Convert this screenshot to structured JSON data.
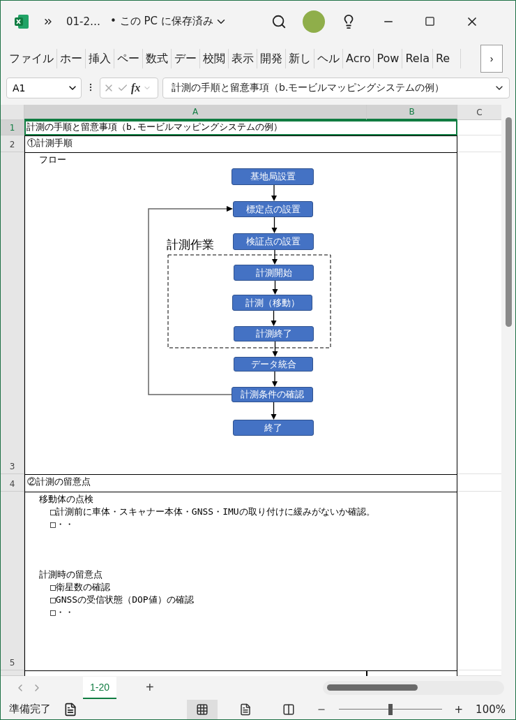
{
  "window": {
    "file_name": "01-2…",
    "save_status": "• この PC に保存済み"
  },
  "ribbon_tabs": [
    "ファイル",
    "ホー",
    "挿入",
    "ペー",
    "数式",
    "デー",
    "校閲",
    "表示",
    "開発",
    "新し",
    "ヘル",
    "Acro",
    "Pow",
    "Rela",
    "Re"
  ],
  "ribbon_more": "›",
  "formula_bar": {
    "name_box": "A1",
    "fx_label": "fx",
    "formula": "計測の手順と留意事項（b.モービルマッピングシステムの例）"
  },
  "columns": [
    {
      "label": "A",
      "selected": true
    },
    {
      "label": "B",
      "selected": true
    },
    {
      "label": "C",
      "selected": false
    }
  ],
  "rows": [
    {
      "number": "1",
      "kind": "title",
      "text": "計測の手順と留意事項（b.モービルマッピングシステムの例）",
      "selected": true
    },
    {
      "number": "2",
      "kind": "heading",
      "text": "①計測手順",
      "selected": false
    },
    {
      "number": "3",
      "kind": "flow",
      "label": "フロー",
      "group_label": "計測作業",
      "selected": false,
      "nodes": [
        "基地局設置",
        "標定点の設置",
        "検証点の設置",
        "計測開始",
        "計測（移動）",
        "計測終了",
        "データ統合",
        "計測条件の確認",
        "終了"
      ]
    },
    {
      "number": "4",
      "kind": "heading",
      "text": "②計測の留意点",
      "selected": false
    },
    {
      "number": "5",
      "kind": "notes",
      "selected": false,
      "sections": [
        {
          "heading": "移動体の点検",
          "items": [
            "□計測前に車体・スキャナー本体・GNSS・IMUの取り付けに緩みがないか確認。",
            "□・・"
          ]
        },
        {
          "heading": "計測時の留意点",
          "items": [
            "□衛星数の確認",
            "□GNSSの受信状態（DOP値）の確認",
            "□・・"
          ]
        }
      ]
    }
  ],
  "sheet_tabs": [
    {
      "label": "1-20",
      "selected": true
    }
  ],
  "add_sheet": "+",
  "status_bar": {
    "text": "準備完了",
    "zoom": "100%",
    "zoom_slider": {
      "level": 0.5
    },
    "zoom_in": "+",
    "views": [
      {
        "kind": "normal",
        "selected": true
      },
      {
        "kind": "page",
        "selected": false
      },
      {
        "kind": "break",
        "selected": false
      }
    ]
  }
}
